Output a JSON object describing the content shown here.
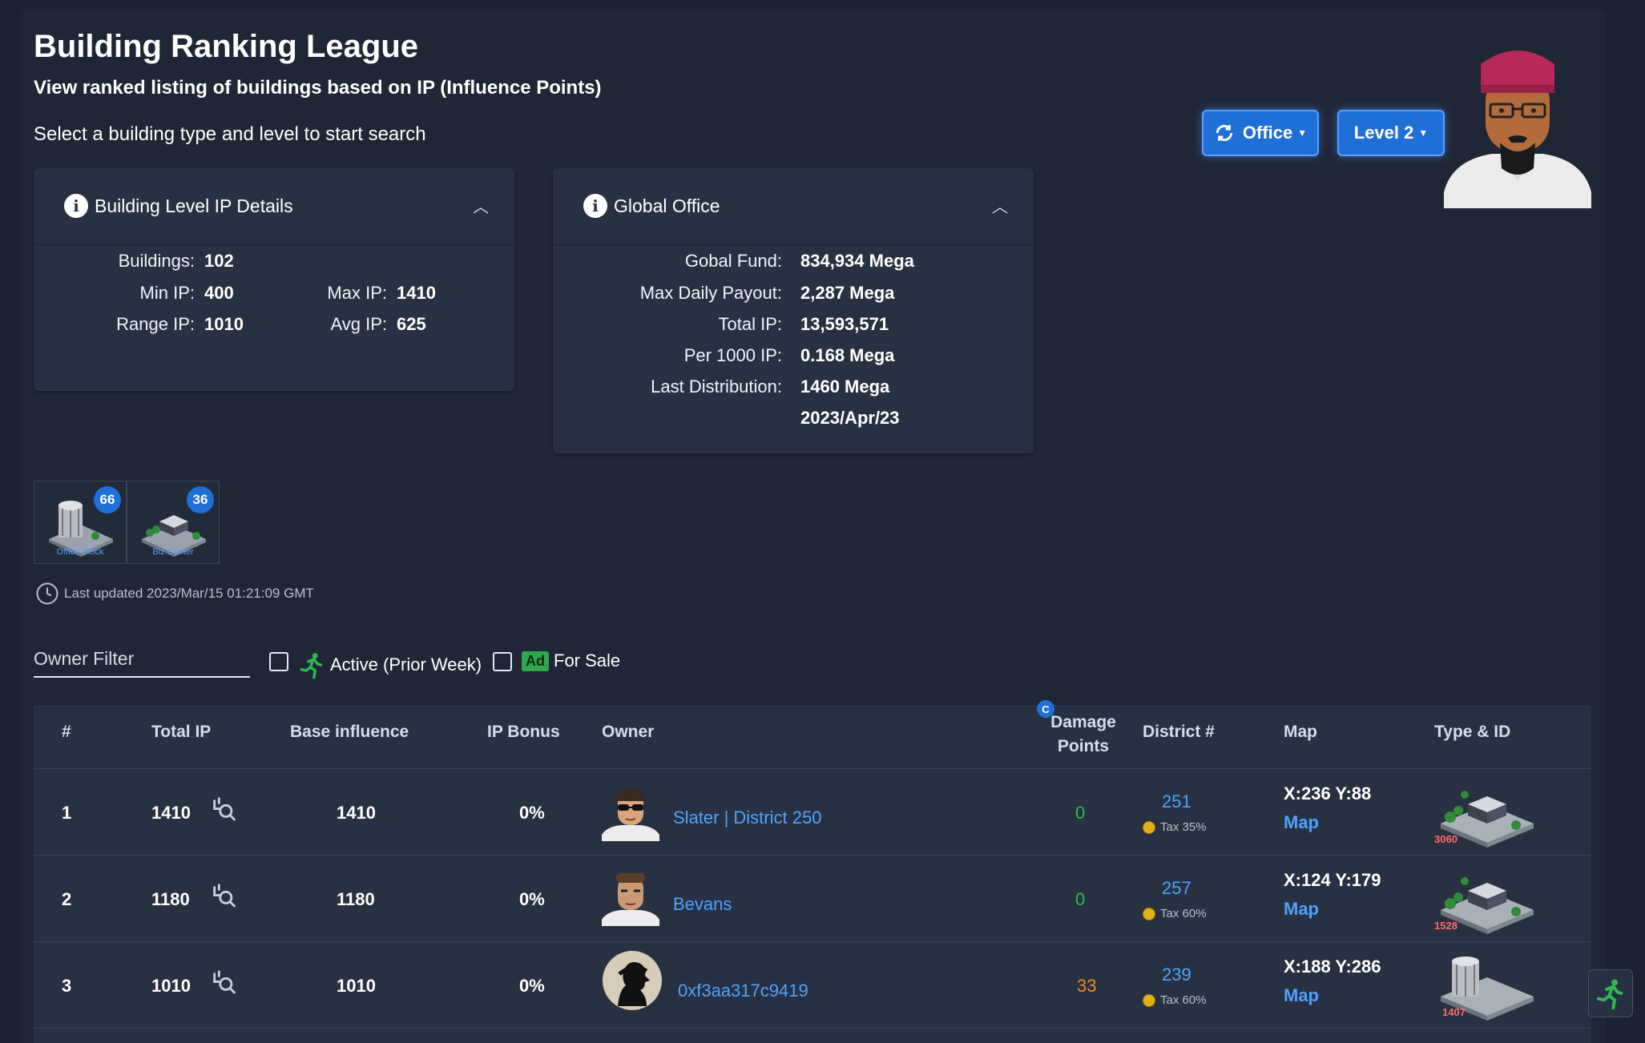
{
  "header": {
    "title": "Building Ranking League",
    "subtitle": "View ranked listing of buildings based on IP (Influence Points)",
    "instruction": "Select a building type and level to start search"
  },
  "buttons": {
    "type_label": "Office",
    "level_label": "Level 2",
    "accent": "#1f6fd6"
  },
  "level_card": {
    "title": "Building Level IP Details",
    "buildings_label": "Buildings:",
    "buildings_value": "102",
    "min_ip_label": "Min IP:",
    "min_ip_value": "400",
    "max_ip_label": "Max IP:",
    "max_ip_value": "1410",
    "range_ip_label": "Range IP:",
    "range_ip_value": "1010",
    "avg_ip_label": "Avg IP:",
    "avg_ip_value": "625"
  },
  "global_card": {
    "title": "Global Office",
    "fund_label": "Gobal Fund:",
    "fund_value": "834,934 Mega",
    "payout_label": "Max Daily Payout:",
    "payout_value": "2,287 Mega",
    "total_ip_label": "Total IP:",
    "total_ip_value": "13,593,571",
    "per1000_label": "Per 1000 IP:",
    "per1000_value": "0.168 Mega",
    "last_dist_label": "Last Distribution:",
    "last_dist_value": "1460 Mega",
    "last_dist_date": "2023/Apr/23"
  },
  "type_tiles": [
    {
      "label": "Office Block",
      "count": "66",
      "icon": "office-block-icon"
    },
    {
      "label": "Biz Center",
      "count": "36",
      "icon": "biz-center-icon"
    }
  ],
  "updated": "Last updated 2023/Mar/15 01:21:09 GMT",
  "filters": {
    "owner_placeholder": "Owner Filter",
    "active_label": "Active (Prior Week)",
    "ad_badge": "Ad",
    "for_sale_label": "For Sale"
  },
  "table": {
    "headers": {
      "rank": "#",
      "total_ip": "Total IP",
      "base_influence": "Base influence",
      "ip_bonus": "IP Bonus",
      "owner": "Owner",
      "damage_badge": "C",
      "damage_line1": "Damage",
      "damage_line2": "Points",
      "district": "District #",
      "map": "Map",
      "type_id": "Type & ID"
    },
    "rows": [
      {
        "rank": "1",
        "total_ip": "1410",
        "base": "1410",
        "bonus": "0%",
        "owner": "Slater | District 250",
        "damage": "0",
        "district": "251",
        "tax": "Tax 35%",
        "coords": "X:236 Y:88",
        "map": "Map",
        "building_id": "3060"
      },
      {
        "rank": "2",
        "total_ip": "1180",
        "base": "1180",
        "bonus": "0%",
        "owner": "Bevans",
        "damage": "0",
        "district": "257",
        "tax": "Tax 60%",
        "coords": "X:124 Y:179",
        "map": "Map",
        "building_id": "1528"
      },
      {
        "rank": "3",
        "total_ip": "1010",
        "base": "1010",
        "bonus": "0%",
        "owner": "0xf3aa317c9419",
        "damage": "33",
        "district": "239",
        "tax": "Tax 60%",
        "coords": "X:188 Y:286",
        "map": "Map",
        "building_id": "1407"
      }
    ]
  }
}
